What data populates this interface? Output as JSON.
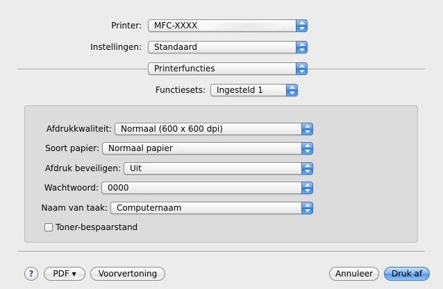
{
  "printer": {
    "label": "Printer:",
    "value": "MFC-XXXX"
  },
  "presets": {
    "label": "Instellingen:",
    "value": "Standaard"
  },
  "panel": {
    "value": "Printerfuncties"
  },
  "feature_sets": {
    "label": "Functiesets:",
    "value": "Ingesteld 1"
  },
  "options": [
    {
      "label": "Afdrukkwaliteit:",
      "value": "Normaal (600 x 600 dpi)"
    },
    {
      "label": "Soort papier:",
      "value": "Normaal papier"
    },
    {
      "label": "Afdruk beveiligen:",
      "value": "Uit"
    },
    {
      "label": "Wachtwoord:",
      "value": "0000"
    },
    {
      "label": "Naam van taak:",
      "value": "Computernaam"
    }
  ],
  "toner_save": {
    "label": "Toner-bespaarstand",
    "checked": false
  },
  "buttons": {
    "help": "?",
    "pdf": "PDF ▾",
    "preview": "Voorvertoning",
    "cancel": "Annuleer",
    "print": "Druk af"
  }
}
